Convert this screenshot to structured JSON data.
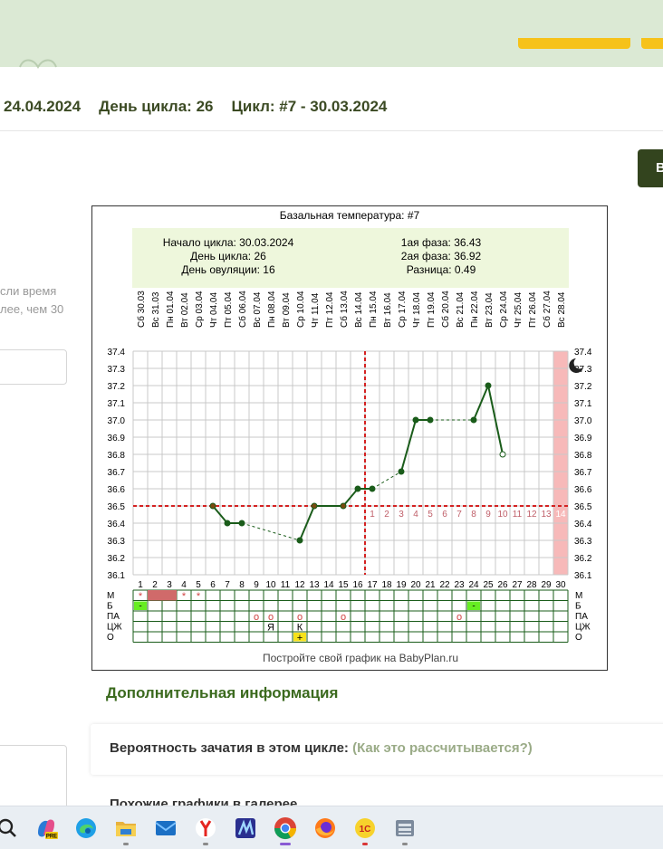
{
  "header": {
    "date": "24.04.2024",
    "cycle_day": "День цикла: 26",
    "cycle": "Цикл: #7 - 30.03.2024",
    "button_label": "В"
  },
  "left_panel": {
    "hint_line1": "сли время",
    "hint_line2": "лее, чем 30"
  },
  "chart_data": {
    "type": "line",
    "title": "Базальная температура: #7",
    "summary": {
      "left": [
        "Начало цикла: 30.03.2024",
        "День цикла: 26",
        "День овуляции: 16"
      ],
      "right": [
        "1ая фаза: 36.43",
        "2ая фаза: 36.92",
        "Разница: 0.49"
      ]
    },
    "dates": [
      "Сб 30.03",
      "Вс 31.03",
      "Пн 01.04",
      "Вт 02.04",
      "Ср 03.04",
      "Чт 04.04",
      "Пт 05.04",
      "Сб 06.04",
      "Вс 07.04",
      "Пн 08.04",
      "Вт 09.04",
      "Ср 10.04",
      "Чт 11.04",
      "Пт 12.04",
      "Сб 13.04",
      "Вс 14.04",
      "Пн 15.04",
      "Вт 16.04",
      "Ср 17.04",
      "Чт 18.04",
      "Пт 19.04",
      "Сб 20.04",
      "Вс 21.04",
      "Пн 22.04",
      "Вт 23.04",
      "Ср 24.04",
      "Чт 25.04",
      "Пт 26.04",
      "Сб 27.04",
      "Вс 28.04"
    ],
    "days": [
      1,
      2,
      3,
      4,
      5,
      6,
      7,
      8,
      9,
      10,
      11,
      12,
      13,
      14,
      15,
      16,
      17,
      18,
      19,
      20,
      21,
      22,
      23,
      24,
      25,
      26,
      27,
      28,
      29,
      30
    ],
    "y_ticks": [
      "37.4",
      "37.3",
      "37.2",
      "37.1",
      "37.0",
      "36.9",
      "36.8",
      "36.7",
      "36.6",
      "36.5",
      "36.4",
      "36.3",
      "36.2",
      "36.1"
    ],
    "ylim": [
      36.1,
      37.4
    ],
    "points": [
      {
        "day": 6,
        "temp": 36.5
      },
      {
        "day": 7,
        "temp": 36.4
      },
      {
        "day": 8,
        "temp": 36.4
      },
      {
        "day": 12,
        "temp": 36.3
      },
      {
        "day": 13,
        "temp": 36.5
      },
      {
        "day": 15,
        "temp": 36.5
      },
      {
        "day": 16,
        "temp": 36.6
      },
      {
        "day": 17,
        "temp": 36.6
      },
      {
        "day": 19,
        "temp": 36.7
      },
      {
        "day": 20,
        "temp": 37.0
      },
      {
        "day": 21,
        "temp": 37.0
      },
      {
        "day": 24,
        "temp": 37.0
      },
      {
        "day": 25,
        "temp": 37.2
      },
      {
        "day": 26,
        "temp": 36.8
      }
    ],
    "gap_segments": [
      [
        8,
        12
      ],
      [
        17,
        19
      ],
      [
        21,
        24
      ]
    ],
    "coverline": 36.5,
    "ovulation_day": 16,
    "luteal_days": [
      "1",
      "2",
      "3",
      "4",
      "5",
      "6",
      "7",
      "8",
      "9",
      "10",
      "11",
      "12",
      "13",
      "14"
    ],
    "luteal_highlight": "14",
    "forecast_day": 30,
    "rows": {
      "labels": [
        "М",
        "Б",
        "ПА",
        "ЦЖ",
        "О"
      ],
      "M": {
        "2": "bar",
        "3": "bar",
        "1": "*",
        "4": "*",
        "5": "*"
      },
      "B": {
        "1": "-",
        "24": "-"
      },
      "PA": {
        "9": "o",
        "10": "o",
        "12": "o",
        "15": "o",
        "23": "o"
      },
      "TsZh": {
        "10": "Я",
        "12": "К"
      },
      "O": {
        "12": "+"
      }
    },
    "footer": "Постройте свой график на BabyPlan.ru",
    "colors": {
      "line": "#1a5c1a",
      "coverline": "#d42222",
      "highlight": "#f7b9b9",
      "summary_bg": "#eef7dc",
      "grid": "#c9c9c9",
      "bar": "#d06a6a",
      "green_cell": "#66ee22",
      "yellow_cell": "#f6e21a"
    }
  },
  "additional": {
    "title": "Дополнительная информация",
    "prob_label": "Вероятность зачатия в этом цикле:",
    "prob_link": "(Как это рассчитывается?)",
    "similar": "Похожие графики в галерее"
  },
  "taskbar": {
    "icons": [
      "search-icon",
      "copilot-icon",
      "edge-icon",
      "file-explorer-icon",
      "mail-icon",
      "yandex-icon",
      "app-icon",
      "chrome-icon",
      "firefox-icon",
      "1c-icon",
      "archive-icon"
    ]
  }
}
